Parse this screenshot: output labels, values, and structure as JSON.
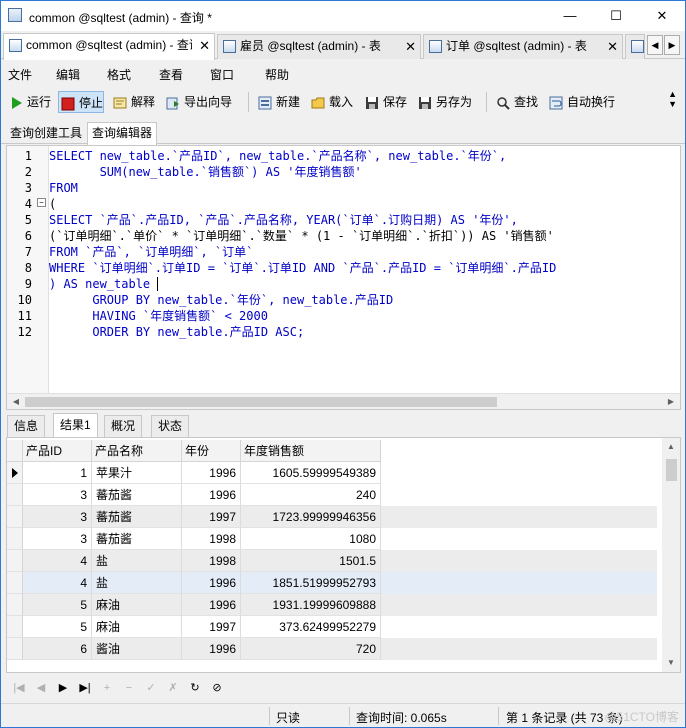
{
  "window": {
    "title": "common @sqltest (admin) - 查询 *",
    "minimize": "—",
    "maximize": "☐",
    "close": "✕"
  },
  "doc_tabs": [
    {
      "label": "common @sqltest (admin) - 查询 *",
      "close": "✕"
    },
    {
      "label": "雇员 @sqltest (admin) - 表",
      "close": "✕"
    },
    {
      "label": "订单 @sqltest (admin) - 表",
      "close": "✕"
    }
  ],
  "tab_scroll": {
    "left": "◀",
    "right": "▶"
  },
  "menu": [
    "文件",
    "编辑",
    "格式",
    "查看",
    "窗口",
    "帮助"
  ],
  "toolbar": {
    "run": "运行",
    "stop": "停止",
    "explain": "解释",
    "export_wizard": "导出向导",
    "new": "新建",
    "load": "载入",
    "save": "保存",
    "save_as": "另存为",
    "find": "查找",
    "word_wrap": "自动换行",
    "more": "▲\n▼"
  },
  "colors": {
    "run": "#1f9e1f",
    "stop": "#d41f1f",
    "keyword": "#0000c8",
    "string": "#c80000"
  },
  "sub_tabs": [
    "查询创建工具",
    "查询编辑器"
  ],
  "editor": {
    "fold_marker": "−",
    "lines": [
      "SELECT new_table.`产品ID`, new_table.`产品名称`, new_table.`年份`,",
      "       SUM(new_table.`销售额`) AS '年度销售额'",
      "FROM",
      "(",
      "SELECT `产品`.产品ID, `产品`.产品名称, YEAR(`订单`.订购日期) AS '年份',",
      "(`订单明细`.`单价` * `订单明细`.`数量` * (1 - `订单明细`.`折扣`)) AS '销售额'",
      "FROM `产品`, `订单明细`, `订单`",
      "WHERE `订单明细`.订单ID = `订单`.订单ID AND `产品`.产品ID = `订单明细`.产品ID",
      ") AS new_table",
      "      GROUP BY new_table.`年份`, new_table.产品ID",
      "      HAVING `年度销售额` < 2000",
      "      ORDER BY new_table.产品ID ASC;"
    ],
    "line_numbers": [
      "1",
      "2",
      "3",
      "4",
      "5",
      "6",
      "7",
      "8",
      "9",
      "10",
      "11",
      "12"
    ]
  },
  "result_tabs": [
    "信息",
    "结果1",
    "概况",
    "状态"
  ],
  "grid": {
    "columns": [
      "产品ID",
      "产品名称",
      "年份",
      "年度销售额"
    ],
    "rows": [
      {
        "id": "1",
        "name": "苹果汁",
        "year": "1996",
        "sales": "1605.59999549389"
      },
      {
        "id": "3",
        "name": "蕃茄酱",
        "year": "1996",
        "sales": "240"
      },
      {
        "id": "3",
        "name": "蕃茄酱",
        "year": "1997",
        "sales": "1723.99999946356"
      },
      {
        "id": "3",
        "name": "蕃茄酱",
        "year": "1998",
        "sales": "1080"
      },
      {
        "id": "4",
        "name": "盐",
        "year": "1998",
        "sales": "1501.5"
      },
      {
        "id": "4",
        "name": "盐",
        "year": "1996",
        "sales": "1851.51999952793"
      },
      {
        "id": "5",
        "name": "麻油",
        "year": "1996",
        "sales": "1931.19999609888"
      },
      {
        "id": "5",
        "name": "麻油",
        "year": "1997",
        "sales": "373.62499952279"
      },
      {
        "id": "6",
        "name": "酱油",
        "year": "1996",
        "sales": "720"
      }
    ]
  },
  "nav": [
    "|◀",
    "◀",
    "▶",
    "▶|",
    "+",
    "−",
    "✓",
    "✗",
    "↻",
    "⊘"
  ],
  "status": {
    "mode": "只读",
    "query_time": "查询时间: 0.065s",
    "record": "第 1 条记录 (共 73 条)",
    "watermark": "@51CTO博客"
  }
}
